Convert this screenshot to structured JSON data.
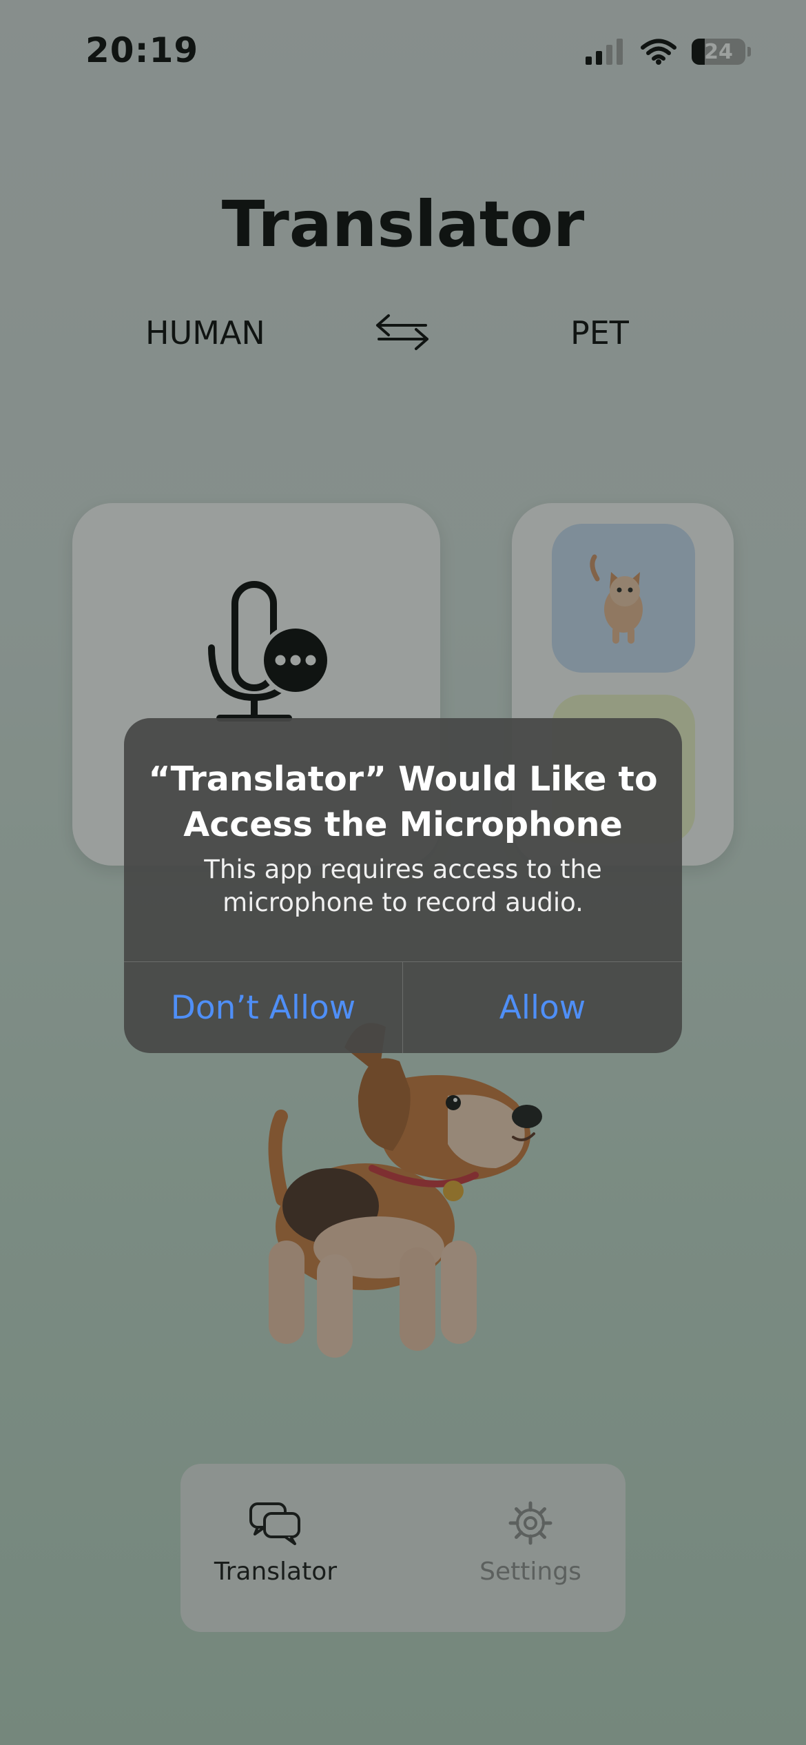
{
  "status_bar": {
    "time": "20:19",
    "battery": "24",
    "battery_level": 0.24,
    "signal_icon": "cellular-signal-icon",
    "wifi_icon": "wifi-icon"
  },
  "header": {
    "title": "Translator",
    "source_language": "HUMAN",
    "target_language": "PET",
    "swap_icon": "swap-arrows-icon"
  },
  "cards": {
    "record_icon": "microphone-with-dots-icon",
    "pets": [
      "cat",
      "dog"
    ]
  },
  "alert": {
    "title": "“Translator” Would Like to Access the Microphone",
    "message": "This app requires access to the microphone to record audio.",
    "deny_label": "Don’t Allow",
    "allow_label": "Allow"
  },
  "tabbar": {
    "tabs": [
      {
        "label": "Translator",
        "icon": "chat-bubbles-icon",
        "active": true
      },
      {
        "label": "Settings",
        "icon": "gear-icon",
        "active": false
      }
    ]
  },
  "colors": {
    "accent": "#4f8ff7",
    "background_top": "#d9dede",
    "background_bottom": "#b8d2c2",
    "alert_background": "#464846"
  }
}
